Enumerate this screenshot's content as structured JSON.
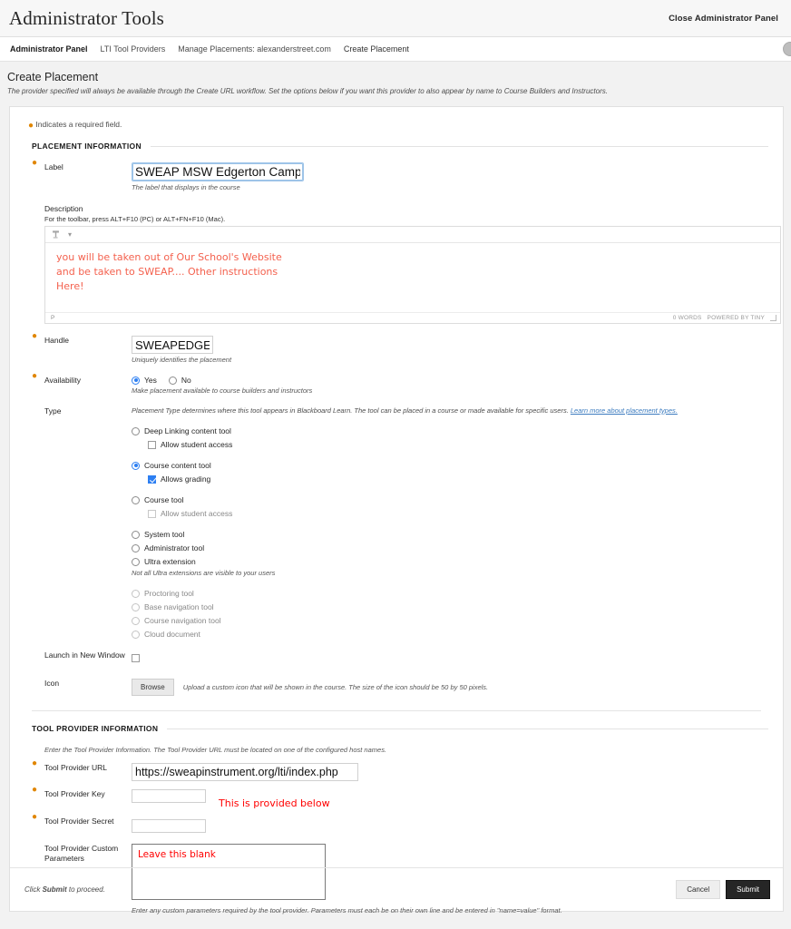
{
  "topbar": {
    "title": "Administrator Tools",
    "close_label": "Close Administrator Panel"
  },
  "breadcrumb": {
    "items": [
      {
        "label": "Administrator Panel"
      },
      {
        "label": "LTI Tool Providers"
      },
      {
        "label": "Manage Placements: alexanderstreet.com"
      },
      {
        "label": "Create Placement"
      }
    ]
  },
  "page": {
    "title": "Create Placement",
    "description": "The provider specified will always be available through the Create URL workflow. Set the options below if you want this provider to also appear by name to Course Builders and Instructors.",
    "required_note": "Indicates a required field."
  },
  "placement_section": {
    "heading": "PLACEMENT INFORMATION",
    "label": {
      "label": "Label",
      "value": "SWEAP MSW Edgerton Campus",
      "hint": "The label that displays in the course"
    },
    "description": {
      "label": "Description",
      "sub": "For the toolbar, press ALT+F10 (PC) or ALT+FN+F10 (Mac).",
      "body_lines": [
        "you will be taken out of Our School's Website",
        "and be taken to SWEAP.... Other instructions",
        "Here!"
      ],
      "status_path": "P",
      "word_count": "0 WORDS",
      "powered_by": "POWERED BY TINY"
    },
    "handle": {
      "label": "Handle",
      "value": "SWEAPEDGE",
      "hint": "Uniquely identifies the placement"
    },
    "availability": {
      "label": "Availability",
      "yes_label": "Yes",
      "no_label": "No",
      "selected": "Yes",
      "hint": "Make placement available to course builders and instructors"
    },
    "type": {
      "label": "Type",
      "intro": "Placement Type determines where this tool appears in Blackboard Learn. The tool can be placed in a course or made available for specific users. ",
      "intro_link": "Learn more about placement types.",
      "options": [
        {
          "label": "Deep Linking content tool",
          "selected": false,
          "disabled": false,
          "child": {
            "kind": "checkbox",
            "label": "Allow student access",
            "checked": false,
            "disabled": false
          }
        },
        {
          "label": "Course content tool",
          "selected": true,
          "disabled": false,
          "child": {
            "kind": "checkbox",
            "label": "Allows grading",
            "checked": true,
            "disabled": false
          }
        },
        {
          "label": "Course tool",
          "selected": false,
          "disabled": false,
          "child": {
            "kind": "checkbox",
            "label": "Allow student access",
            "checked": false,
            "disabled": true
          }
        },
        {
          "label": "System tool",
          "selected": false,
          "disabled": false
        },
        {
          "label": "Administrator tool",
          "selected": false,
          "disabled": false
        },
        {
          "label": "Ultra extension",
          "selected": false,
          "disabled": false
        }
      ],
      "ultra_note": "Not all Ultra extensions are visible to your users",
      "disabled_options": [
        {
          "label": "Proctoring tool",
          "selected": false,
          "disabled": true
        },
        {
          "label": "Base navigation tool",
          "selected": false,
          "disabled": true
        },
        {
          "label": "Course navigation tool",
          "selected": false,
          "disabled": true
        },
        {
          "label": "Cloud document",
          "selected": false,
          "disabled": true
        }
      ]
    },
    "launch_new_window": {
      "label": "Launch in New Window",
      "checked": false
    },
    "icon": {
      "label": "Icon",
      "browse_label": "Browse",
      "hint": "Upload a custom icon that will be shown in the course. The size of the icon should be 50 by 50 pixels."
    }
  },
  "provider_section": {
    "heading": "TOOL PROVIDER INFORMATION",
    "intro": "Enter the Tool Provider Information. The Tool Provider URL must be located on one of the configured host names.",
    "url": {
      "label": "Tool Provider URL",
      "value": "https://sweapinstrument.org/lti/index.php"
    },
    "key": {
      "label": "Tool Provider Key",
      "value": ""
    },
    "secret": {
      "label": "Tool Provider Secret",
      "value": ""
    },
    "annotation": "This is provided below",
    "custom_params": {
      "label": "Tool Provider Custom Parameters",
      "value": "Leave this blank",
      "hint": "Enter any custom parameters required by the tool provider. Parameters must each be on their own line and be entered in \"name=value\" format."
    }
  },
  "footer": {
    "note_prefix": "Click ",
    "note_strong": "Submit",
    "note_suffix": " to proceed.",
    "cancel_label": "Cancel",
    "submit_label": "Submit"
  },
  "colors": {
    "required_star": "#e08600",
    "accent_blue": "#2d7ff2",
    "annotation_red": "#ff0000",
    "editor_text_red": "#f4614e",
    "submit_bg": "#262626"
  }
}
